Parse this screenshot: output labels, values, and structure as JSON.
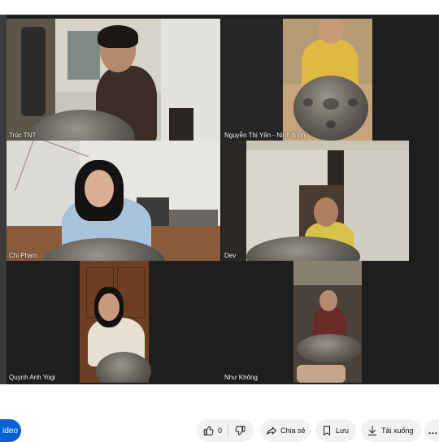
{
  "participants": [
    {
      "name": "Trúc TNT"
    },
    {
      "name": "Nguyễn Thị Yến - Ninh Bình"
    },
    {
      "name": "Chi Phạm"
    },
    {
      "name": "Dev"
    },
    {
      "name": "Quynh Anh Yogi"
    },
    {
      "name": "Như Không"
    }
  ],
  "actions": {
    "video_label": "ideo",
    "like_count": "0",
    "share_label": "Chia sẻ",
    "save_label": "Lưu",
    "download_label": "Tải xuống"
  },
  "colors": {
    "background": "#1e1e1e",
    "accent": "#065fd4",
    "pill": "#f2f2f2"
  },
  "icons": [
    "thumb-up-icon",
    "thumb-down-icon",
    "share-icon",
    "bookmark-icon",
    "download-icon",
    "more-icon"
  ]
}
